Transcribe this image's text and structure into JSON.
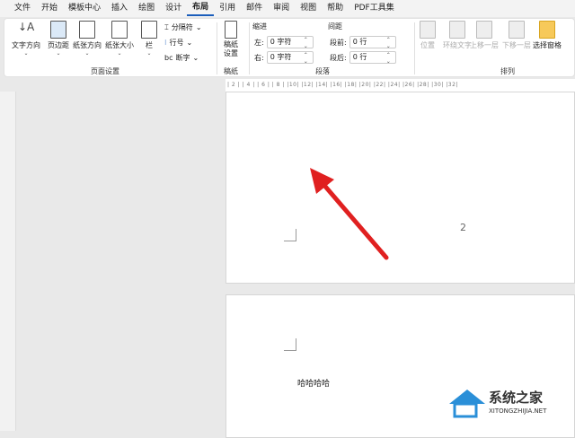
{
  "tabs": [
    "文件",
    "开始",
    "模板中心",
    "插入",
    "绘图",
    "设计",
    "布局",
    "引用",
    "邮件",
    "审阅",
    "视图",
    "帮助",
    "PDF工具集"
  ],
  "active_tab": "布局",
  "page_setup": {
    "text_direction": "文字方向",
    "margins": "页边距",
    "orientation": "纸张方向",
    "size": "纸张大小",
    "columns": "栏",
    "breaks": "分隔符",
    "line_numbers": "行号",
    "hyphenation": "断字",
    "label": "页面设置"
  },
  "manuscript": {
    "button": "稿纸设置",
    "label": "稿纸"
  },
  "paragraph": {
    "indent": "缩进",
    "left": "左:",
    "left_val": "0 字符",
    "right": "右:",
    "right_val": "0 字符",
    "spacing": "间距",
    "before": "段前:",
    "before_val": "0 行",
    "after": "段后:",
    "after_val": "0 行",
    "label": "段落"
  },
  "arrange": {
    "position": "位置",
    "wrap": "环绕文字",
    "forward": "上移一层",
    "backward": "下移一层",
    "pane": "选择窗格",
    "label": "排列"
  },
  "ruler": "| 2 |  | 4 |  | 6 |  | 8 |  |10|  |12|  |14|  |16|  |18|  |20|  |22|  |24|  |26|  |28|  |30|  |32|",
  "document": {
    "page_number": "2",
    "body_text": "哈哈哈哈"
  },
  "watermark": {
    "title": "系统之家",
    "url": "XITONGZHIJIA.NET"
  },
  "colors": {
    "accent": "#1a5dbb",
    "arrow": "#e02020"
  }
}
